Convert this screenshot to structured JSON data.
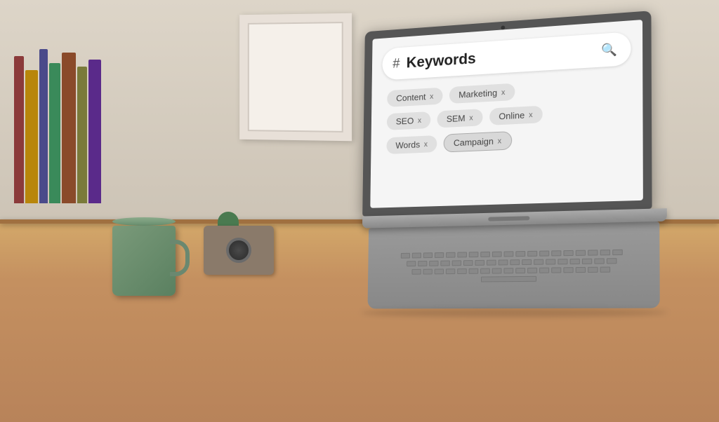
{
  "room": {
    "description": "Desktop workspace with laptop, mug, books, camera, and cactus"
  },
  "laptop": {
    "search_bar": {
      "hash_symbol": "#",
      "placeholder": "Keywords",
      "search_icon": "🔍"
    },
    "tags": [
      [
        {
          "label": "Content",
          "close": "x"
        },
        {
          "label": "Marketing",
          "close": "x"
        }
      ],
      [
        {
          "label": "SEO",
          "close": "x"
        },
        {
          "label": "SEM",
          "close": "x"
        },
        {
          "label": "Online",
          "close": "x"
        }
      ],
      [
        {
          "label": "Words",
          "close": "x"
        },
        {
          "label": "Campaign",
          "close": "x"
        }
      ]
    ]
  }
}
